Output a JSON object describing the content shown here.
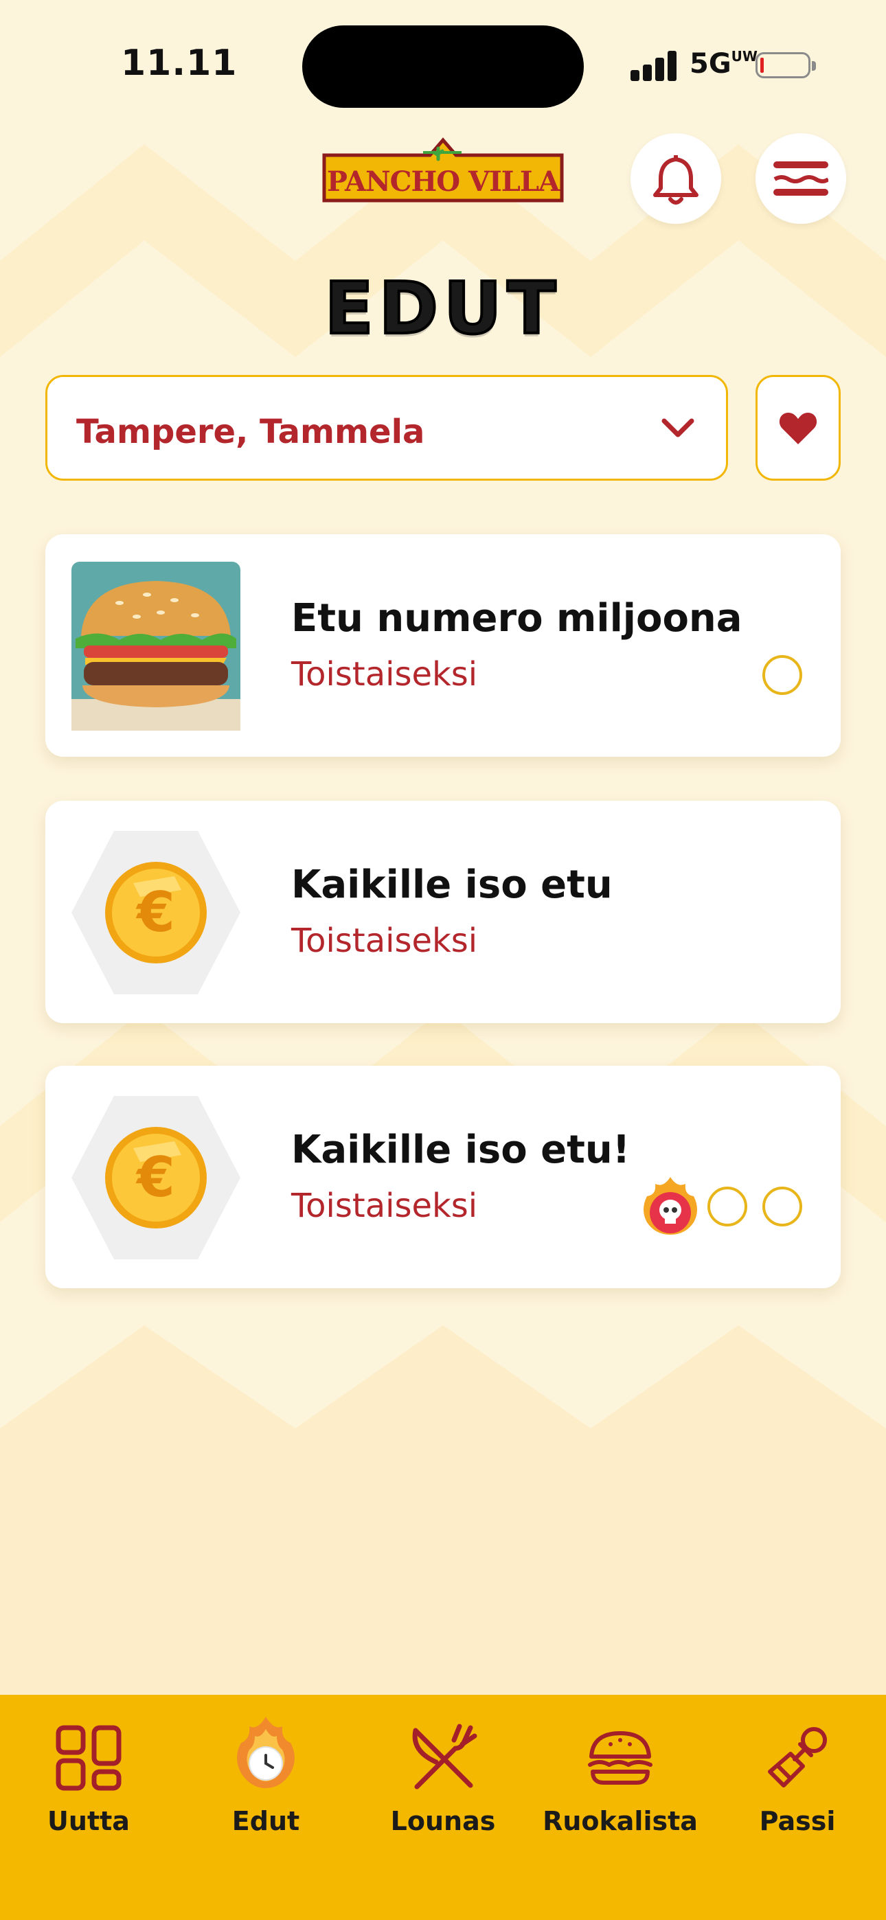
{
  "status_bar": {
    "time": "11.11",
    "network": "5G",
    "network_sup": "UW"
  },
  "header": {
    "logo_text": "PANCHO VILLA",
    "bell_icon": "bell-icon",
    "menu_icon": "hamburger-menu-icon"
  },
  "page": {
    "title": "EDUT"
  },
  "location": {
    "selected": "Tampere, Tammela",
    "chevron_icon": "chevron-down-icon",
    "favorite_icon": "heart-icon"
  },
  "offers": [
    {
      "title": "Etu numero miljoona",
      "subtitle": "Toistaiseksi",
      "image": "burger-image",
      "stamps": 1
    },
    {
      "title": "Kaikille iso etu",
      "subtitle": "Toistaiseksi",
      "image": "euro-coin-icon",
      "stamps": 0
    },
    {
      "title": "Kaikille iso etu!",
      "subtitle": "Toistaiseksi",
      "image": "euro-coin-icon",
      "stamps": 2,
      "badge": "flaming-skull-icon"
    }
  ],
  "bottom_nav": [
    {
      "label": "Uutta",
      "icon": "grid-icon"
    },
    {
      "label": "Edut",
      "icon": "flaming-clock-icon",
      "active": true
    },
    {
      "label": "Lounas",
      "icon": "fork-knife-icon"
    },
    {
      "label": "Ruokalista",
      "icon": "burger-icon"
    },
    {
      "label": "Passi",
      "icon": "stamp-icon"
    }
  ],
  "colors": {
    "accent_red": "#B3262C",
    "accent_yellow": "#F5B800",
    "background": "#FDF4DC"
  }
}
